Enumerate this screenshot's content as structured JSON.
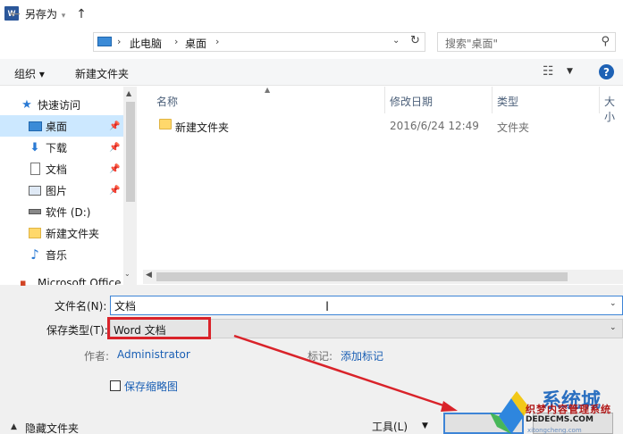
{
  "window": {
    "title": "另存为",
    "app_icon_letter": "W"
  },
  "nav": {
    "breadcrumb": [
      "此电脑",
      "桌面"
    ],
    "search_placeholder": "搜索\"桌面\""
  },
  "toolbar": {
    "organize": "组织 ▾",
    "new_folder": "新建文件夹"
  },
  "sidebar": {
    "items": [
      {
        "label": "快速访问",
        "icon": "star-icon"
      },
      {
        "label": "桌面",
        "icon": "desktop-icon",
        "selected": true,
        "pinned": true
      },
      {
        "label": "下载",
        "icon": "download-icon",
        "pinned": true
      },
      {
        "label": "文档",
        "icon": "document-icon",
        "pinned": true
      },
      {
        "label": "图片",
        "icon": "picture-icon",
        "pinned": true
      },
      {
        "label": "软件 (D:)",
        "icon": "drive-icon"
      },
      {
        "label": "新建文件夹",
        "icon": "folder-icon"
      },
      {
        "label": "音乐",
        "icon": "music-icon"
      }
    ],
    "partial_item": "Microsoft Office"
  },
  "filelist": {
    "columns": [
      "名称",
      "修改日期",
      "类型",
      "大小"
    ],
    "rows": [
      {
        "name": "新建文件夹",
        "modified": "2016/6/24 12:49",
        "type": "文件夹"
      }
    ]
  },
  "form": {
    "filename_label": "文件名(N):",
    "filename_value": "文档",
    "type_label": "保存类型(T):",
    "type_value": "Word 文档",
    "author_label": "作者:",
    "author_value": "Administrator",
    "tags_label": "标记:",
    "tags_value": "添加标记",
    "thumbnail_label": "保存缩略图",
    "hide_folders": "隐藏文件夹",
    "tools_label": "工具(L)"
  },
  "watermark": {
    "big_text": "系统城",
    "mid_text": "织梦内容管理系统",
    "en_text": "DEDECMS.COM",
    "url": "xitongcheng.com"
  },
  "colors": {
    "accent": "#3d84d6",
    "highlight": "#d9232a",
    "selected": "#cce8ff"
  }
}
